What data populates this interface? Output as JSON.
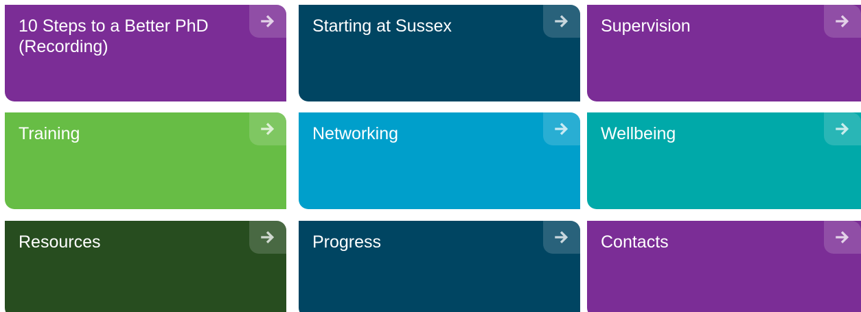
{
  "tiles": [
    {
      "label": "10 Steps to a Better PhD (Recording)",
      "color": "#7b2d96",
      "icon": "arrow-right-icon"
    },
    {
      "label": "Starting at Sussex",
      "color": "#004562",
      "icon": "arrow-right-icon"
    },
    {
      "label": "Supervision",
      "color": "#7b2d96",
      "icon": "arrow-right-icon"
    },
    {
      "label": "Training",
      "color": "#67bd45",
      "icon": "arrow-right-icon"
    },
    {
      "label": "Networking",
      "color": "#009fcb",
      "icon": "arrow-right-icon"
    },
    {
      "label": "Wellbeing",
      "color": "#00a9a9",
      "icon": "arrow-right-icon"
    },
    {
      "label": "Resources",
      "color": "#274d1f",
      "icon": "arrow-right-icon"
    },
    {
      "label": "Progress",
      "color": "#004562",
      "icon": "arrow-right-icon"
    },
    {
      "label": "Contacts",
      "color": "#7b2d96",
      "icon": "arrow-right-icon"
    }
  ]
}
